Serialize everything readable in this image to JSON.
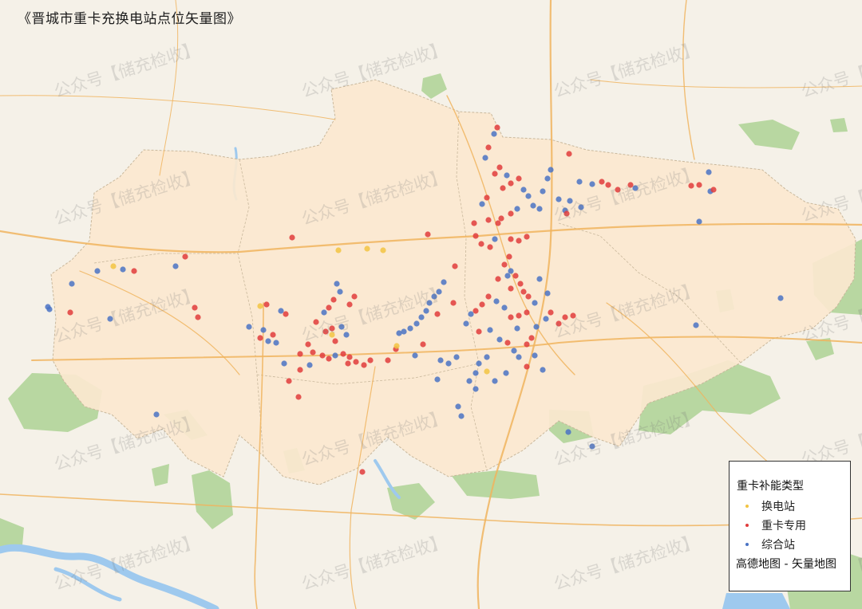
{
  "title": "《晋城市重卡充换电站点位矢量图》",
  "legend": {
    "title": "重卡补能类型",
    "items": [
      {
        "label": "换电站",
        "color": "#f2c443"
      },
      {
        "label": "重卡专用",
        "color": "#e03c3c"
      },
      {
        "label": "综合站",
        "color": "#4a73c4"
      }
    ],
    "source": "高德地图 - 矢量地图"
  },
  "watermark": "公众号【储充检收】",
  "colors": {
    "region_fill": "#fbe8cf",
    "background": "#f5f1e8",
    "green": "#a9d18e",
    "water": "#9ec9ee",
    "road": "#f0b45e"
  }
}
